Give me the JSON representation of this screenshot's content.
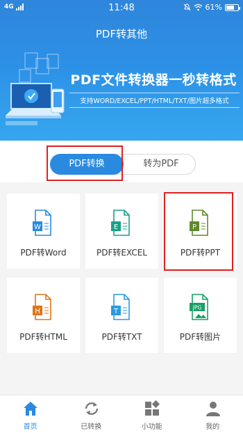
{
  "status_bar": {
    "network": "4G",
    "time": "11:48",
    "battery": "61%"
  },
  "app_title": "PDF转其他",
  "banner": {
    "title": "PDF文件转换器一秒转格式",
    "subtitle": "支持WORD/EXCEL/PPT/HTML/TXT/图片超多格式"
  },
  "tabs": [
    {
      "label": "PDF转换",
      "active": true
    },
    {
      "label": "转为PDF",
      "active": false
    }
  ],
  "tools": [
    {
      "label": "PDF转Word",
      "letter": "W",
      "color": "#2a8ae0",
      "icon": "word-doc-icon"
    },
    {
      "label": "PDF转EXCEL",
      "letter": "E",
      "color": "#1aa08a",
      "icon": "excel-doc-icon"
    },
    {
      "label": "PDF转PPT",
      "letter": "P",
      "color": "#5e8a2c",
      "icon": "ppt-doc-icon"
    },
    {
      "label": "PDF转HTML",
      "letter": "H",
      "color": "#e0761a",
      "icon": "html-doc-icon"
    },
    {
      "label": "PDF转TXT",
      "letter": "T",
      "color": "#2a9be0",
      "icon": "txt-doc-icon"
    },
    {
      "label": "PDF转图片",
      "letter": "JPG",
      "color": "#1aa066",
      "icon": "image-doc-icon"
    }
  ],
  "bottom_nav": [
    {
      "label": "首页",
      "active": true,
      "icon": "home-icon"
    },
    {
      "label": "已转换",
      "active": false,
      "icon": "refresh-icon"
    },
    {
      "label": "小功能",
      "active": false,
      "icon": "apps-icon"
    },
    {
      "label": "我的",
      "active": false,
      "icon": "user-icon"
    }
  ],
  "colors": {
    "primary": "#2a8ae0",
    "highlight": "#e02020"
  }
}
